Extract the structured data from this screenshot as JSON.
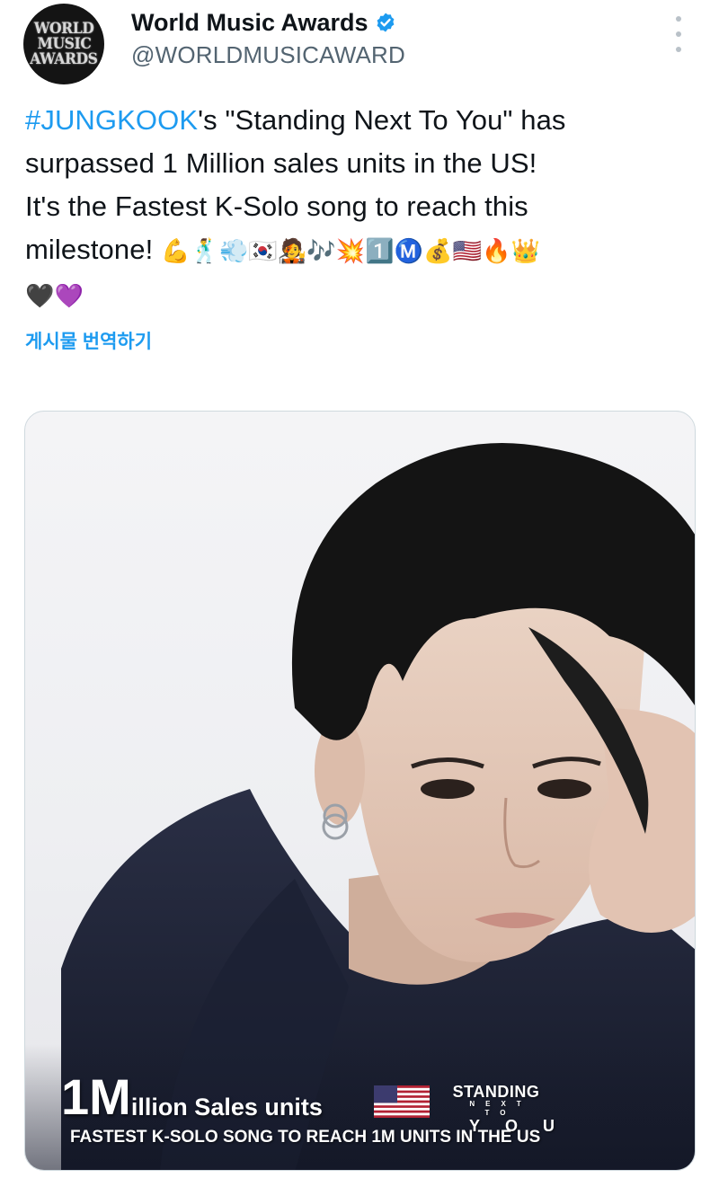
{
  "account": {
    "avatar_lines": [
      "WORLD",
      "MUSIC",
      "AWARDS"
    ],
    "display_name": "World Music Awards",
    "handle": "@WORLDMUSICAWARD",
    "verified_icon": "verified-badge-icon"
  },
  "tweet": {
    "hashtag": "#JUNGKOOK",
    "line1_rest": "'s \"Standing Next To You\" has",
    "line2": "surpassed 1 Million sales units in the US!",
    "line3": "It's the Fastest K-Solo song to reach this",
    "line4": "milestone!",
    "emojis_row1": "💪🕺💨🇰🇷🧑‍🎤🎶💥1️⃣Ⓜ️💰🇺🇸🔥👑",
    "emojis_row2": "🖤💜",
    "translate_label": "게시물 번역하기"
  },
  "media": {
    "caption_big_1": "1 ",
    "caption_big_m": "M",
    "caption_small": "illion Sales units",
    "snty_top": "STANDING",
    "snty_mid": "NEXT TO",
    "snty_bottom": "YOU",
    "subcaption": "FASTEST K-SOLO SONG TO REACH 1M UNITS IN THE US"
  },
  "colors": {
    "link": "#1d9bf0",
    "text": "#0f1419",
    "secondary": "#536471"
  }
}
